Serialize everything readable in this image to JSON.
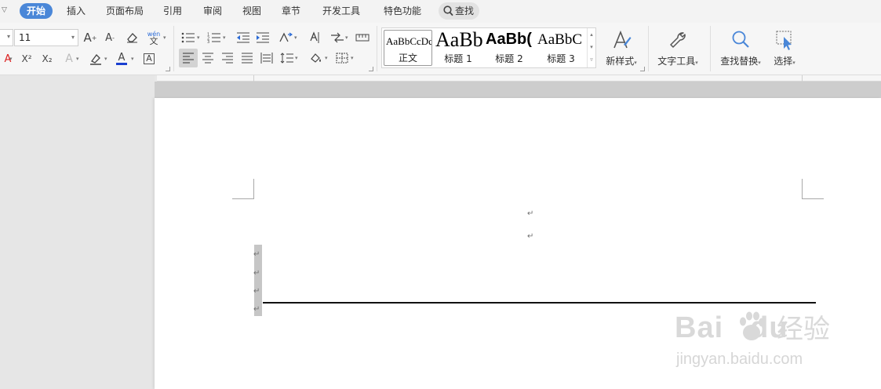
{
  "menu": {
    "tabs": [
      "开始",
      "插入",
      "页面布局",
      "引用",
      "审阅",
      "视图",
      "章节",
      "开发工具",
      "特色功能"
    ],
    "active_tab": "开始",
    "search_label": "查找"
  },
  "ribbon": {
    "font_size": "11",
    "styles": [
      {
        "preview": "AaBbCcDd",
        "caption": "正文"
      },
      {
        "preview": "AaBb",
        "caption": "标题 1"
      },
      {
        "preview": "AaBb(",
        "caption": "标题 2"
      },
      {
        "preview": "AaBbC",
        "caption": "标题 3"
      }
    ],
    "new_style_label": "新样式",
    "text_tools_label": "文字工具",
    "find_replace_label": "查找替换",
    "select_label": "选择",
    "phonetic_glyph": "wén",
    "phonetic_char": "文",
    "superscript_glyph": "X²",
    "subscript_glyph": "X₂",
    "font_color_glyph": "A",
    "char_border_glyph": "A",
    "text_effect_glyph": "A",
    "clear_format_glyph": "A",
    "grow_font_glyph": "A",
    "shrink_font_glyph": "A",
    "accent_blue": "#4a87d8",
    "font_color_red": "#d22"
  },
  "document": {
    "paragraph_mark": "↵"
  },
  "watermark": {
    "brand": "Bai",
    "brand_tail": "du",
    "brand_cn": "经验",
    "url": "jingyan.baidu.com"
  }
}
